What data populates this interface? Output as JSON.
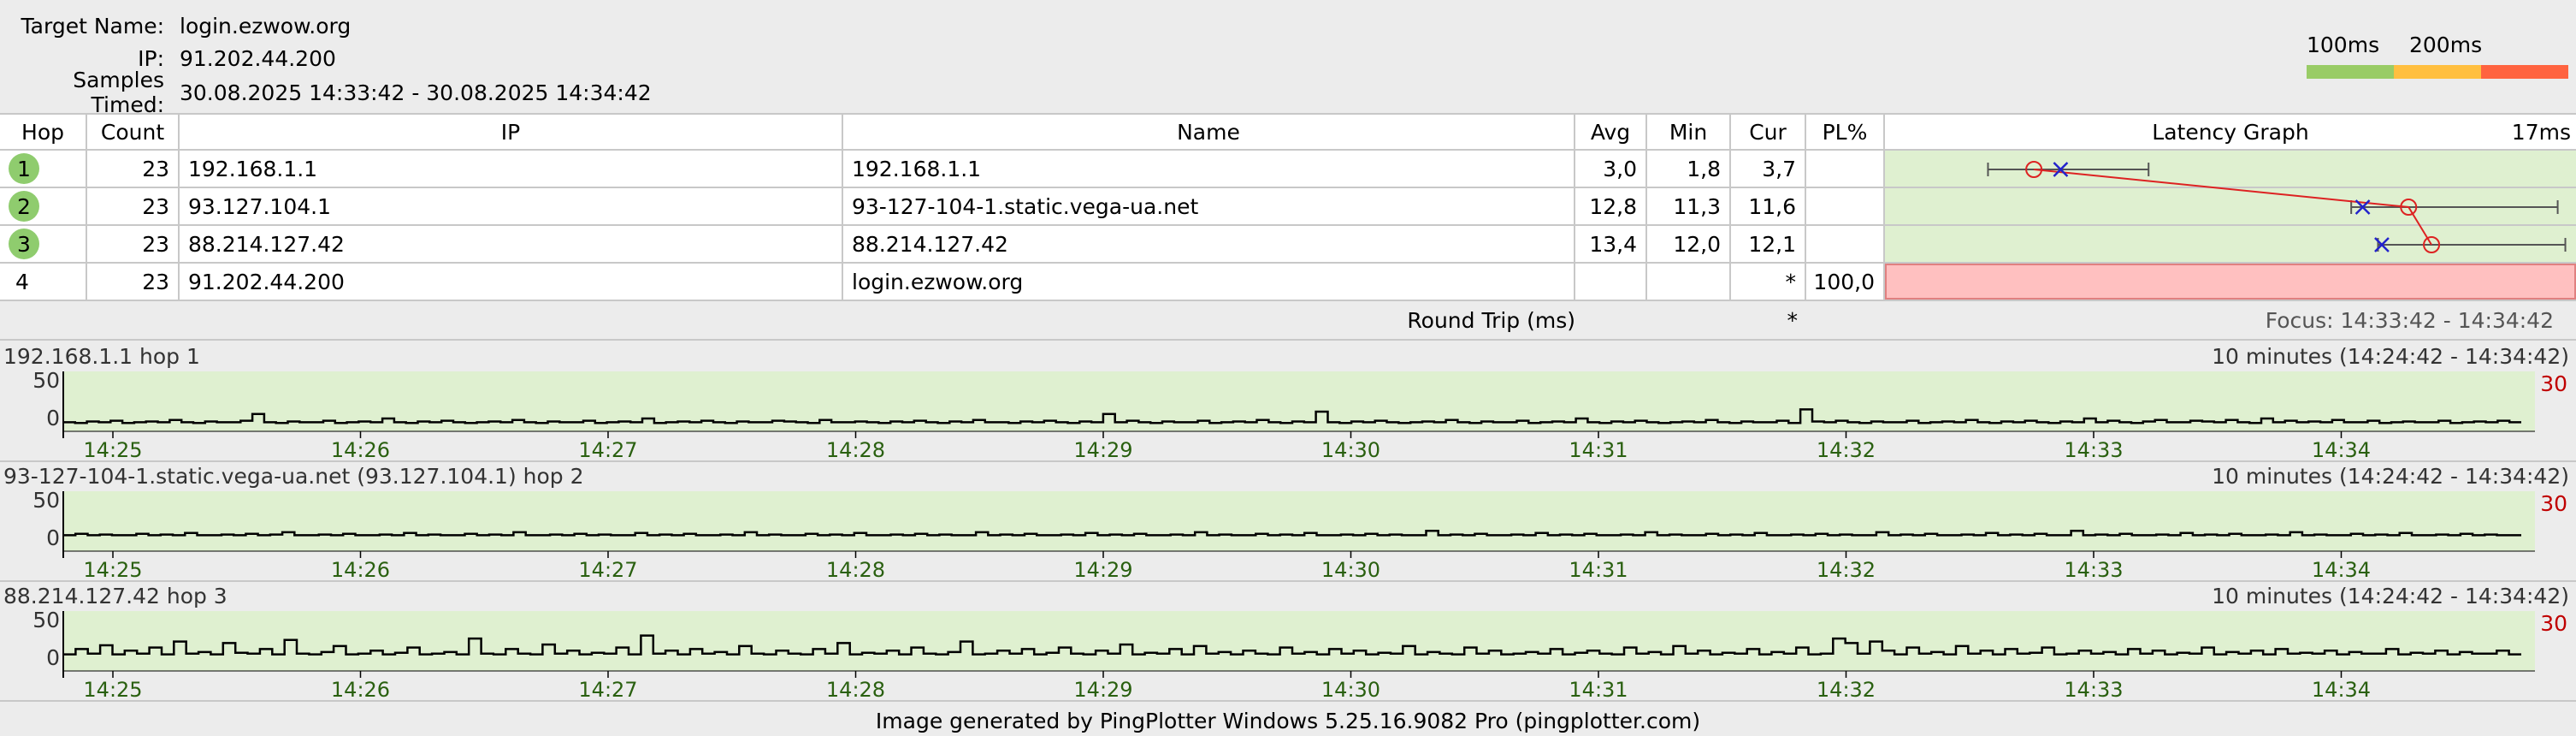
{
  "header": {
    "target_label": "Target Name:",
    "target_value": "login.ezwow.org",
    "ip_label": "IP:",
    "ip_value": "91.202.44.200",
    "samples_label": "Samples Timed:",
    "samples_value": "30.08.2025 14:33:42 - 30.08.2025 14:34:42",
    "scale_100": "100ms",
    "scale_200": "200ms",
    "scale_colors": [
      "#99cc66",
      "#ffbf40",
      "#ff6340"
    ]
  },
  "table": {
    "columns": {
      "hop": "Hop",
      "count": "Count",
      "ip": "IP",
      "name": "Name",
      "avg": "Avg",
      "min": "Min",
      "cur": "Cur",
      "pl": "PL%",
      "graph": "Latency Graph",
      "graph_scale": "17ms"
    },
    "rows": [
      {
        "hop": "1",
        "count": "23",
        "ip": "192.168.1.1",
        "name": "192.168.1.1",
        "avg": "3,0",
        "min": "1,8",
        "cur": "3,7",
        "pl": "",
        "avg_ms": 3.0,
        "min_ms": 1.8,
        "cur_ms": 3.7,
        "max_ms": 6.0,
        "ok": true
      },
      {
        "hop": "2",
        "count": "23",
        "ip": "93.127.104.1",
        "name": "93-127-104-1.static.vega-ua.net",
        "avg": "12,8",
        "min": "11,3",
        "cur": "11,6",
        "pl": "",
        "avg_ms": 12.8,
        "min_ms": 11.3,
        "cur_ms": 11.6,
        "max_ms": 16.7,
        "ok": true
      },
      {
        "hop": "3",
        "count": "23",
        "ip": "88.214.127.42",
        "name": "88.214.127.42",
        "avg": "13,4",
        "min": "12,0",
        "cur": "12,1",
        "pl": "",
        "avg_ms": 13.4,
        "min_ms": 12.0,
        "cur_ms": 12.1,
        "max_ms": 16.9,
        "ok": true
      },
      {
        "hop": "4",
        "count": "23",
        "ip": "91.202.44.200",
        "name": "login.ezwow.org",
        "avg": "",
        "min": "",
        "cur": "*",
        "pl": "100,0",
        "ok": false
      }
    ],
    "graph_max_ms": 17,
    "colors": {
      "graph_bg": "#dff0d0",
      "loss_bg": "#ffc0c0",
      "avg_line": "#dd2222",
      "cur_mark": "#2222cc"
    },
    "footer_label": "Round Trip (ms)",
    "footer_cur": "*",
    "focus": "Focus: 14:33:42 - 14:34:42"
  },
  "hop_charts": [
    {
      "title": "192.168.1.1 hop 1",
      "range": "10 minutes (14:24:42 - 14:34:42)",
      "max_label": "30",
      "y_labels": [
        "50",
        "0"
      ],
      "times": [
        "14:25",
        "14:26",
        "14:27",
        "14:28",
        "14:29",
        "14:30",
        "14:31",
        "14:32",
        "14:33",
        "14:34"
      ],
      "values": [
        3,
        2,
        4,
        3,
        5,
        2,
        3,
        4,
        3,
        6,
        3,
        2,
        4,
        3,
        3,
        5,
        14,
        3,
        2,
        4,
        3,
        3,
        5,
        2,
        3,
        4,
        3,
        8,
        3,
        2,
        4,
        3,
        5,
        3,
        2,
        3,
        4,
        3,
        6,
        3,
        2,
        4,
        3,
        3,
        5,
        2,
        3,
        4,
        3,
        8,
        2,
        3,
        4,
        3,
        5,
        3,
        2,
        4,
        3,
        3,
        5,
        4,
        3,
        2,
        6,
        3,
        3,
        4,
        3,
        2,
        4,
        3,
        5,
        3,
        2,
        4,
        3,
        6,
        3,
        3,
        2,
        4,
        3,
        5,
        3,
        2,
        4,
        3,
        14,
        3,
        5,
        3,
        2,
        4,
        3,
        3,
        5,
        2,
        3,
        4,
        3,
        6,
        3,
        2,
        4,
        3,
        17,
        3,
        2,
        4,
        3,
        5,
        3,
        2,
        3,
        4,
        3,
        6,
        3,
        2,
        4,
        3,
        3,
        5,
        2,
        3,
        4,
        3,
        8,
        3,
        2,
        4,
        3,
        5,
        3,
        2,
        3,
        4,
        3,
        6,
        3,
        2,
        4,
        3,
        3,
        5,
        2,
        20,
        4,
        3,
        5,
        3,
        2,
        4,
        3,
        3,
        5,
        2,
        3,
        4,
        3,
        6,
        3,
        2,
        4,
        3,
        5,
        3,
        2,
        4,
        3,
        8,
        3,
        5,
        3,
        2,
        4,
        6,
        3,
        3,
        5,
        4,
        3,
        6,
        3,
        2,
        8,
        3,
        5,
        3,
        4,
        3,
        6,
        3,
        3,
        5,
        2,
        3,
        4,
        3,
        3,
        5,
        2,
        3,
        4,
        3,
        5,
        3
      ]
    },
    {
      "title": "93-127-104-1.static.vega-ua.net (93.127.104.1) hop 2",
      "range": "10 minutes (14:24:42 - 14:34:42)",
      "max_label": "30",
      "y_labels": [
        "50",
        "0"
      ],
      "times": [
        "14:25",
        "14:26",
        "14:27",
        "14:28",
        "14:29",
        "14:30",
        "14:31",
        "14:32",
        "14:33",
        "14:34"
      ],
      "values": [
        12,
        14,
        12,
        13,
        12,
        12,
        14,
        12,
        13,
        12,
        15,
        12,
        12,
        13,
        12,
        14,
        12,
        13,
        16,
        12,
        12,
        13,
        12,
        14,
        12,
        12,
        13,
        12,
        15,
        12,
        13,
        12,
        12,
        14,
        12,
        13,
        12,
        16,
        12,
        12,
        13,
        12,
        14,
        12,
        13,
        12,
        12,
        15,
        12,
        13,
        12,
        14,
        12,
        12,
        13,
        12,
        16,
        12,
        13,
        12,
        12,
        14,
        12,
        13,
        12,
        15,
        12,
        12,
        13,
        12,
        14,
        12,
        13,
        12,
        12,
        16,
        12,
        13,
        12,
        14,
        12,
        12,
        13,
        12,
        15,
        12,
        13,
        12,
        14,
        12,
        12,
        13,
        12,
        16,
        12,
        13,
        12,
        12,
        14,
        12,
        13,
        12,
        15,
        12,
        12,
        13,
        12,
        14,
        12,
        13,
        12,
        12,
        18,
        12,
        13,
        12,
        14,
        12,
        12,
        13,
        12,
        15,
        12,
        13,
        12,
        14,
        12,
        12,
        13,
        12,
        16,
        12,
        13,
        12,
        12,
        14,
        12,
        13,
        12,
        15,
        12,
        12,
        13,
        12,
        14,
        12,
        13,
        12,
        12,
        16,
        12,
        13,
        12,
        14,
        12,
        12,
        13,
        12,
        15,
        12,
        13,
        12,
        14,
        12,
        12,
        18,
        12,
        13,
        12,
        14,
        12,
        12,
        13,
        12,
        15,
        12,
        13,
        12,
        14,
        12,
        12,
        13,
        12,
        16,
        12,
        13,
        12,
        12,
        14,
        12,
        13,
        12,
        15,
        12,
        12,
        13,
        12,
        14,
        12,
        13,
        12,
        12
      ]
    },
    {
      "title": "88.214.127.42 hop 3",
      "range": "10 minutes (14:24:42 - 14:34:42)",
      "max_label": "30",
      "y_labels": [
        "50",
        "0"
      ],
      "times": [
        "14:25",
        "14:26",
        "14:27",
        "14:28",
        "14:29",
        "14:30",
        "14:31",
        "14:32",
        "14:33",
        "14:34"
      ],
      "values": [
        13,
        20,
        14,
        25,
        13,
        18,
        14,
        22,
        13,
        30,
        14,
        16,
        13,
        28,
        15,
        14,
        20,
        13,
        32,
        14,
        13,
        16,
        24,
        13,
        14,
        18,
        13,
        15,
        22,
        13,
        14,
        16,
        13,
        34,
        14,
        13,
        20,
        14,
        13,
        26,
        14,
        18,
        13,
        15,
        14,
        22,
        13,
        38,
        14,
        18,
        13,
        20,
        14,
        16,
        13,
        24,
        14,
        13,
        18,
        14,
        13,
        20,
        14,
        28,
        13,
        15,
        14,
        18,
        13,
        22,
        14,
        13,
        16,
        30,
        13,
        14,
        18,
        14,
        20,
        13,
        15,
        22,
        14,
        13,
        18,
        14,
        26,
        13,
        15,
        14,
        20,
        13,
        24,
        14,
        16,
        13,
        18,
        14,
        13,
        22,
        14,
        16,
        13,
        20,
        14,
        18,
        13,
        15,
        14,
        24,
        13,
        16,
        14,
        13,
        22,
        14,
        18,
        13,
        14,
        16,
        14,
        20,
        13,
        15,
        18,
        14,
        13,
        22,
        14,
        16,
        13,
        24,
        14,
        18,
        13,
        15,
        14,
        20,
        13,
        16,
        14,
        22,
        13,
        14,
        34,
        28,
        14,
        30,
        18,
        13,
        22,
        14,
        16,
        13,
        24,
        14,
        18,
        13,
        20,
        14,
        15,
        22,
        13,
        14,
        18,
        14,
        16,
        13,
        20,
        14,
        18,
        13,
        15,
        14,
        22,
        13,
        16,
        14,
        18,
        13,
        20,
        14,
        15,
        14,
        18,
        13,
        16,
        14,
        14,
        20,
        13,
        15,
        14,
        18,
        13,
        16,
        14,
        14,
        18,
        13
      ]
    }
  ],
  "chart_colors": {
    "bg": "#dff0d0",
    "line": "#000000",
    "tick_label": "#2a6010"
  },
  "footer": "Image generated by PingPlotter Windows 5.25.16.9082 Pro (pingplotter.com)"
}
